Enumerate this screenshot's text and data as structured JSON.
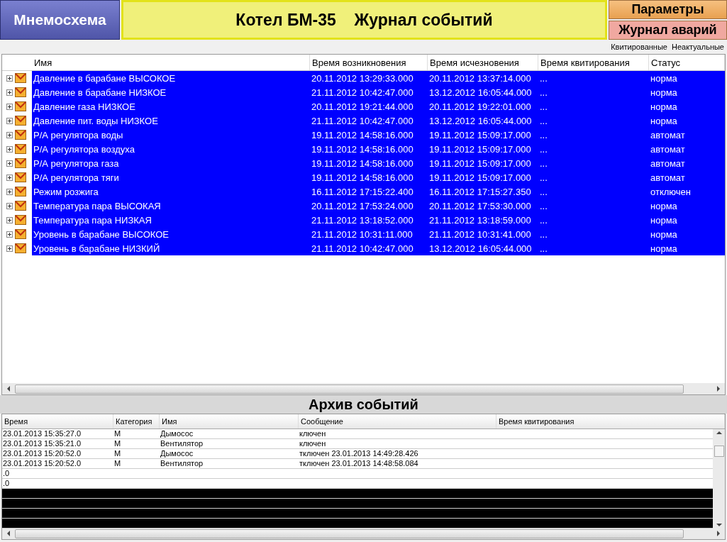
{
  "header": {
    "mnemo_button": "Мнемосхема",
    "title": "Котел БМ-35    Журнал событий",
    "params_button": "Параметры",
    "alarms_button": "Журнал аварий"
  },
  "filters": [
    "Квитированные",
    "Неактуальные"
  ],
  "events": {
    "columns": [
      "Имя",
      "Время возникновения",
      "Время исчезновения",
      "Время квитирования",
      "Статус"
    ],
    "rows": [
      {
        "name": "Давление в барабане ВЫСОКОЕ",
        "start": "20.11.2012 13:29:33.000",
        "end": "20.11.2012 13:37:14.000",
        "ack": "...",
        "status": "норма",
        "selected": true
      },
      {
        "name": "Давление в барабане НИЗКОЕ",
        "start": "21.11.2012 10:42:47.000",
        "end": "13.12.2012 16:05:44.000",
        "ack": "...",
        "status": "норма",
        "selected": true
      },
      {
        "name": "Давление газа НИЗКОЕ",
        "start": "20.11.2012 19:21:44.000",
        "end": "20.11.2012 19:22:01.000",
        "ack": "...",
        "status": "норма",
        "selected": true
      },
      {
        "name": "Давление пит. воды НИЗКОЕ",
        "start": "21.11.2012 10:42:47.000",
        "end": "13.12.2012 16:05:44.000",
        "ack": "...",
        "status": "норма",
        "selected": true
      },
      {
        "name": "Р/А регулятора воды",
        "start": "19.11.2012 14:58:16.000",
        "end": "19.11.2012 15:09:17.000",
        "ack": "...",
        "status": "автомат",
        "selected": true
      },
      {
        "name": "Р/А регулятора воздуха",
        "start": "19.11.2012 14:58:16.000",
        "end": "19.11.2012 15:09:17.000",
        "ack": "...",
        "status": "автомат",
        "selected": true
      },
      {
        "name": "Р/А регулятора газа",
        "start": "19.11.2012 14:58:16.000",
        "end": "19.11.2012 15:09:17.000",
        "ack": "...",
        "status": "автомат",
        "selected": true
      },
      {
        "name": "Р/А регулятора тяги",
        "start": "19.11.2012 14:58:16.000",
        "end": "19.11.2012 15:09:17.000",
        "ack": "...",
        "status": "автомат",
        "selected": true
      },
      {
        "name": "Режим розжига",
        "start": "16.11.2012 17:15:22.400",
        "end": "16.11.2012 17:15:27.350",
        "ack": "...",
        "status": "отключен",
        "selected": true
      },
      {
        "name": "Температура пара ВЫСОКАЯ",
        "start": "20.11.2012 17:53:24.000",
        "end": "20.11.2012 17:53:30.000",
        "ack": "...",
        "status": "норма",
        "selected": true
      },
      {
        "name": "Температура пара НИЗКАЯ",
        "start": "21.11.2012 13:18:52.000",
        "end": "21.11.2012 13:18:59.000",
        "ack": "...",
        "status": "норма",
        "selected": true
      },
      {
        "name": "Уровень в барабане  ВЫСОКОЕ",
        "start": "21.11.2012 10:31:11.000",
        "end": "21.11.2012 10:31:41.000",
        "ack": "...",
        "status": "норма",
        "selected": true
      },
      {
        "name": "Уровень в барабане НИЗКИЙ",
        "start": "21.11.2012 10:42:47.000",
        "end": "13.12.2012 16:05:44.000",
        "ack": "...",
        "status": "норма",
        "selected": true
      }
    ]
  },
  "archive": {
    "title": "Архив событий",
    "columns": [
      "Время",
      "Категория",
      "Имя",
      "Сообщение",
      "Время квитирования"
    ],
    "rows": [
      {
        "kind": "data",
        "time": "23.01.2013 15:35:27.0",
        "category": "М",
        "name": "Дымосос",
        "message": "ключен"
      },
      {
        "kind": "data",
        "time": "23.01.2013 15:35:21.0",
        "category": "М",
        "name": "Вентилятор",
        "message": "ключен"
      },
      {
        "kind": "data",
        "time": "23.01.2013 15:20:52.0",
        "category": "М",
        "name": "Дымосос",
        "message": "тключен 23.01.2013 14:49:28.426"
      },
      {
        "kind": "data",
        "time": "23.01.2013 15:20:52.0",
        "category": "М",
        "name": "Вентилятор",
        "message": "тключен 23.01.2013 14:48:58.084"
      },
      {
        "kind": "data",
        "time": ".0"
      },
      {
        "kind": "data",
        "time": ".0"
      },
      {
        "kind": "black"
      },
      {
        "kind": "black"
      },
      {
        "kind": "black"
      },
      {
        "kind": "black"
      }
    ]
  }
}
